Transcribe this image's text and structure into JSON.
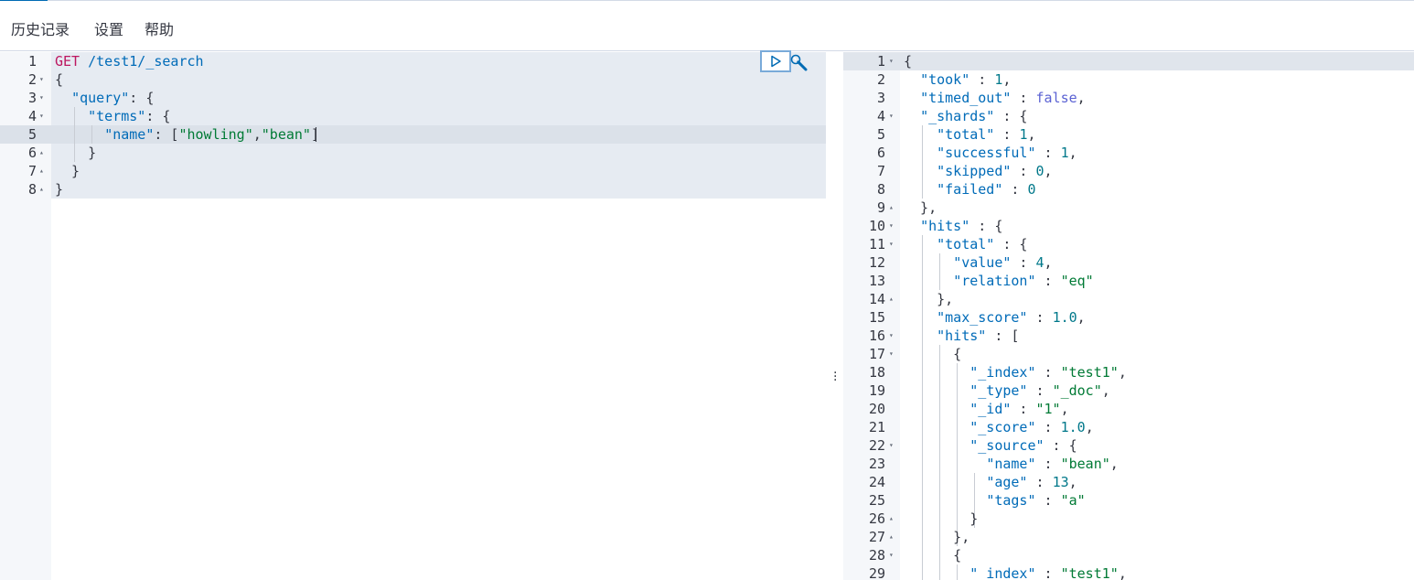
{
  "menu": {
    "history": "历史记录",
    "settings": "设置",
    "help": "帮助"
  },
  "request": {
    "lines": [
      {
        "n": "1",
        "fold": "",
        "html": "<span class=\"m\">GET</span> <span class=\"k\">/test1/_search</span>"
      },
      {
        "n": "2",
        "fold": "▾",
        "html": "{"
      },
      {
        "n": "3",
        "fold": "▾",
        "html": "  <span class=\"k\">\"query\"</span>: {"
      },
      {
        "n": "4",
        "fold": "▾",
        "html": "    <span class=\"k\">\"terms\"</span>: {"
      },
      {
        "n": "5",
        "fold": "",
        "html": "      <span class=\"k\">\"name\"</span>: [<span class=\"s\">\"howling\"</span>,<span class=\"s\">\"bean\"</span>]"
      },
      {
        "n": "6",
        "fold": "▴",
        "html": "    }"
      },
      {
        "n": "7",
        "fold": "▴",
        "html": "  }"
      },
      {
        "n": "8",
        "fold": "▴",
        "html": "}"
      }
    ],
    "active_line": 5
  },
  "response": {
    "lines": [
      {
        "n": "1",
        "fold": "▾",
        "html": "{"
      },
      {
        "n": "2",
        "fold": "",
        "html": "  <span class=\"k\">\"took\"</span> : <span class=\"n\">1</span>,"
      },
      {
        "n": "3",
        "fold": "",
        "html": "  <span class=\"k\">\"timed_out\"</span> : <span class=\"b\">false</span>,"
      },
      {
        "n": "4",
        "fold": "▾",
        "html": "  <span class=\"k\">\"_shards\"</span> : {"
      },
      {
        "n": "5",
        "fold": "",
        "html": "    <span class=\"k\">\"total\"</span> : <span class=\"n\">1</span>,"
      },
      {
        "n": "6",
        "fold": "",
        "html": "    <span class=\"k\">\"successful\"</span> : <span class=\"n\">1</span>,"
      },
      {
        "n": "7",
        "fold": "",
        "html": "    <span class=\"k\">\"skipped\"</span> : <span class=\"n\">0</span>,"
      },
      {
        "n": "8",
        "fold": "",
        "html": "    <span class=\"k\">\"failed\"</span> : <span class=\"n\">0</span>"
      },
      {
        "n": "9",
        "fold": "▴",
        "html": "  },"
      },
      {
        "n": "10",
        "fold": "▾",
        "html": "  <span class=\"k\">\"hits\"</span> : {"
      },
      {
        "n": "11",
        "fold": "▾",
        "html": "    <span class=\"k\">\"total\"</span> : {"
      },
      {
        "n": "12",
        "fold": "",
        "html": "      <span class=\"k\">\"value\"</span> : <span class=\"n\">4</span>,"
      },
      {
        "n": "13",
        "fold": "",
        "html": "      <span class=\"k\">\"relation\"</span> : <span class=\"s\">\"eq\"</span>"
      },
      {
        "n": "14",
        "fold": "▴",
        "html": "    },"
      },
      {
        "n": "15",
        "fold": "",
        "html": "    <span class=\"k\">\"max_score\"</span> : <span class=\"n\">1.0</span>,"
      },
      {
        "n": "16",
        "fold": "▾",
        "html": "    <span class=\"k\">\"hits\"</span> : ["
      },
      {
        "n": "17",
        "fold": "▾",
        "html": "      {"
      },
      {
        "n": "18",
        "fold": "",
        "html": "        <span class=\"k\">\"_index\"</span> : <span class=\"s\">\"test1\"</span>,"
      },
      {
        "n": "19",
        "fold": "",
        "html": "        <span class=\"k\">\"_type\"</span> : <span class=\"s\">\"_doc\"</span>,"
      },
      {
        "n": "20",
        "fold": "",
        "html": "        <span class=\"k\">\"_id\"</span> : <span class=\"s\">\"1\"</span>,"
      },
      {
        "n": "21",
        "fold": "",
        "html": "        <span class=\"k\">\"_score\"</span> : <span class=\"n\">1.0</span>,"
      },
      {
        "n": "22",
        "fold": "▾",
        "html": "        <span class=\"k\">\"_source\"</span> : {"
      },
      {
        "n": "23",
        "fold": "",
        "html": "          <span class=\"k\">\"name\"</span> : <span class=\"s\">\"bean\"</span>,"
      },
      {
        "n": "24",
        "fold": "",
        "html": "          <span class=\"k\">\"age\"</span> : <span class=\"n\">13</span>,"
      },
      {
        "n": "25",
        "fold": "",
        "html": "          <span class=\"k\">\"tags\"</span> : <span class=\"s\">\"a\"</span>"
      },
      {
        "n": "26",
        "fold": "▴",
        "html": "        }"
      },
      {
        "n": "27",
        "fold": "▴",
        "html": "      },"
      },
      {
        "n": "28",
        "fold": "▾",
        "html": "      {"
      },
      {
        "n": "29",
        "fold": "",
        "html": "        <span class=\"k\">\"_index\"</span> : <span class=\"s\">\"test1\"</span>,"
      }
    ]
  },
  "icons": {
    "play": "play-icon",
    "wrench": "wrench-icon",
    "divider": "vertical-dots-icon"
  }
}
